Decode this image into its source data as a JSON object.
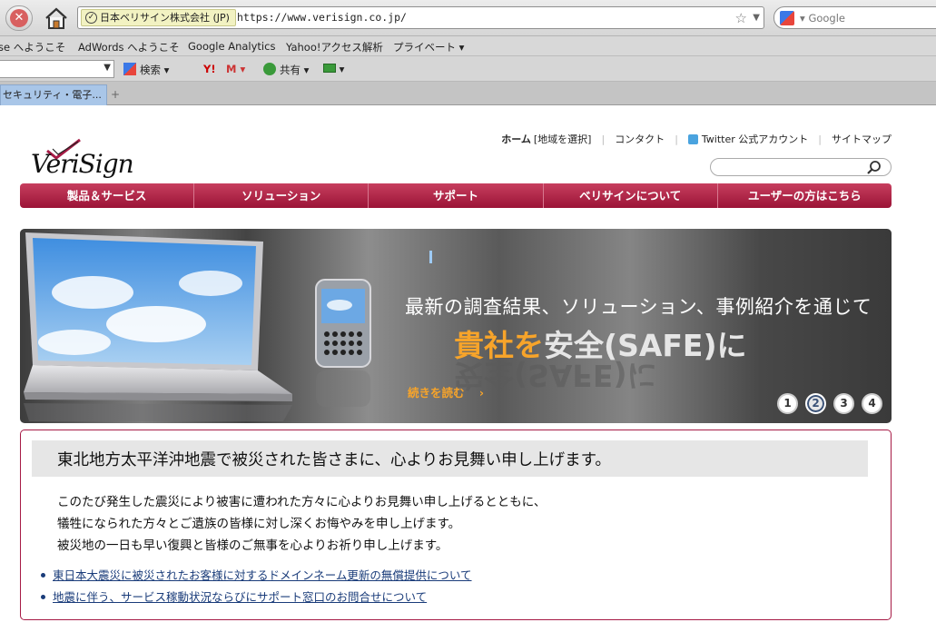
{
  "browser": {
    "site_identity": "日本ベリサイン株式会社 (JP)",
    "url": "https://www.verisign.co.jp/",
    "search_engine": "Google",
    "bookmarks": [
      "se へようこそ",
      "AdWords へようこそ",
      "Google Analytics",
      "Yahoo!アクセス解析",
      "プライベート ▾"
    ],
    "toolbar": {
      "search_label": "検索",
      "share_label": "共有"
    },
    "tab_title": "セキュリティ・電子..."
  },
  "header": {
    "logo": "VeriSign",
    "util_nav": {
      "home": "ホーム",
      "region": "[地域を選択]",
      "contact": "コンタクト",
      "twitter": "Twitter 公式アカウント",
      "sitemap": "サイトマップ"
    }
  },
  "main_nav": [
    "製品＆サービス",
    "ソリューション",
    "サポート",
    "ベリサインについて",
    "ユーザーの方はこちら"
  ],
  "hero": {
    "line1": "最新の調査結果、ソリューション、事例紹介を通じて",
    "line2_orange": "貴社を",
    "line2_white": "安全(SAFE)に",
    "read_more": "続きを読む",
    "read_more_arrow": "›",
    "slides": [
      "1",
      "2",
      "3",
      "4"
    ],
    "active_slide": "2"
  },
  "notice": {
    "heading": "東北地方太平洋沖地震で被災された皆さまに、心よりお見舞い申し上げます。",
    "lines": [
      "このたび発生した震災により被害に遭われた方々に心よりお見舞い申し上げるとともに、",
      "犠牲になられた方々とご遺族の皆様に対し深くお悔やみを申し上げます。",
      "被災地の一日も早い復興と皆様のご無事を心よりお祈り申し上げます。"
    ],
    "links": [
      "東日本大震災に被災されたお客様に対するドメインネーム更新の無償提供について",
      "地震に伴う、サービス稼動状況ならびにサポート窓口のお問合せについて"
    ]
  },
  "colors": {
    "brand_red": "#a61a45",
    "accent_orange": "#f7a42a",
    "link_blue": "#1a3c7a"
  }
}
